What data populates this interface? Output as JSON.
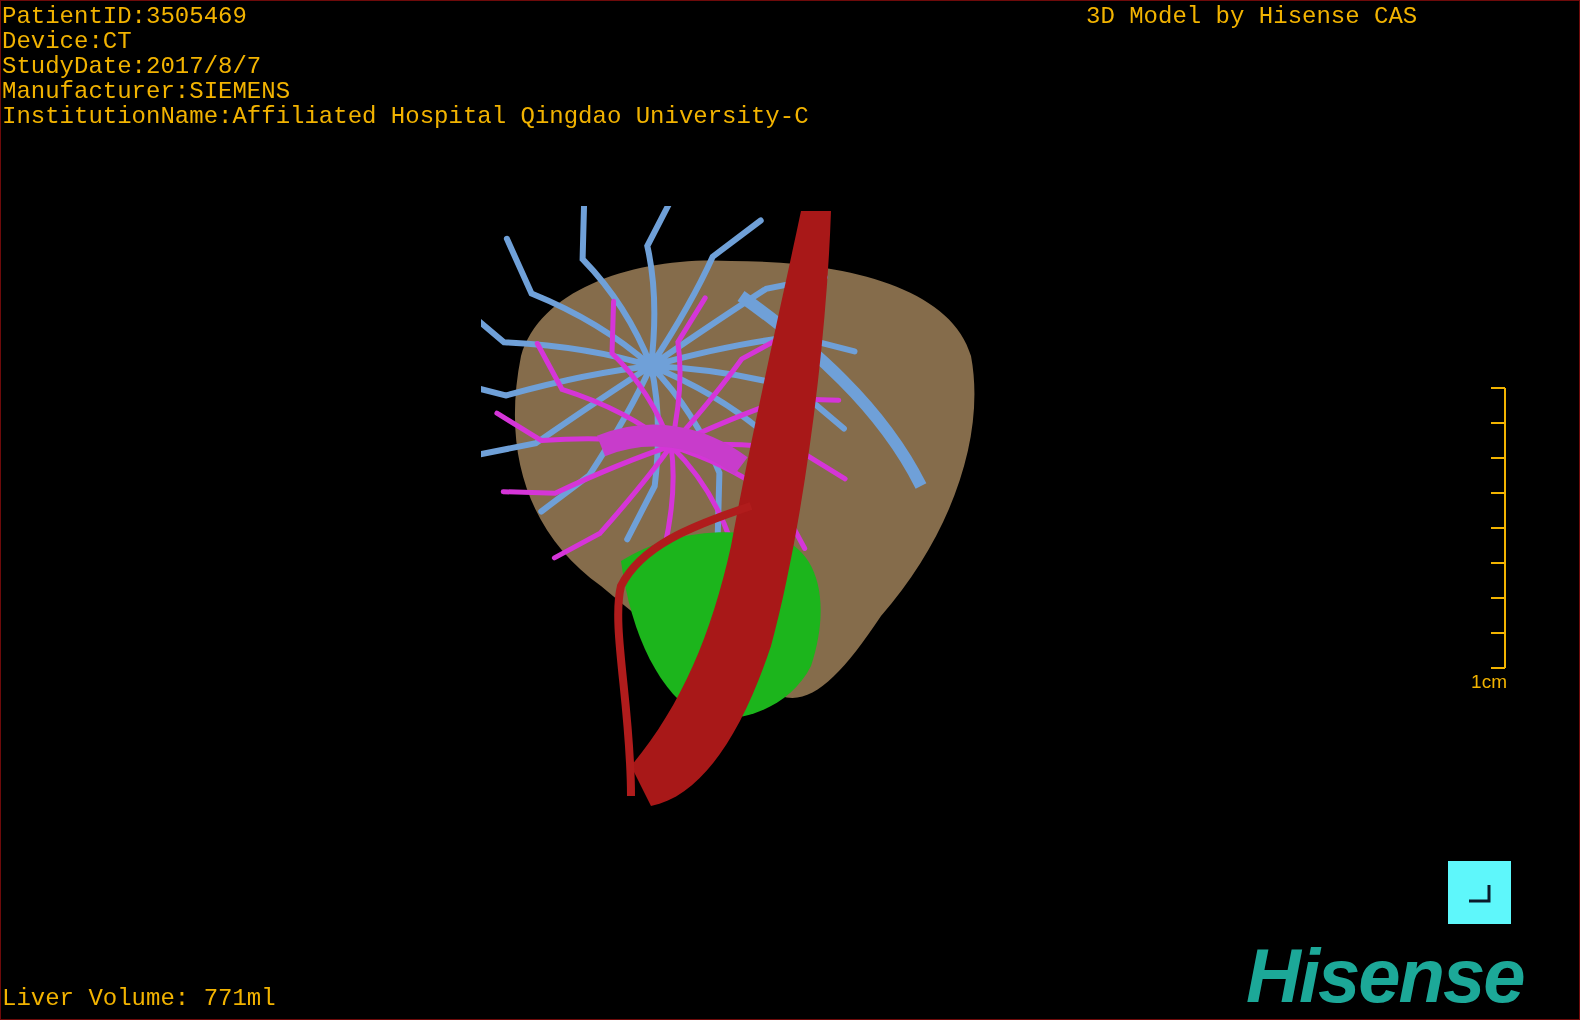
{
  "patient_info": [
    "PatientID:3505469",
    "Device:CT",
    "StudyDate:2017/8/7",
    "Manufacturer:SIEMENS",
    "InstitutionName:Affiliated Hospital Qingdao University-C"
  ],
  "model_credit": "3D Model by Hisense CAS",
  "scale_bar": {
    "label": "1cm"
  },
  "liver_volume": "Liver Volume: 771ml",
  "logo": "Hisense"
}
